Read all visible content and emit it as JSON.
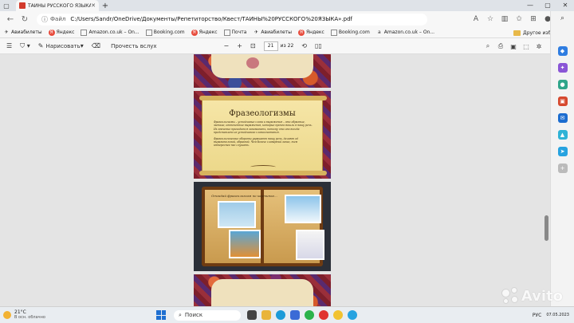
{
  "browser": {
    "tab_title": "ТАЙНЫ РУССКОГО ЯЗЫКА».pdf",
    "address_label": "Файл",
    "url": "C:/Users/Sandr/OneDrive/Документы/Репетиторство/Квест/ТАЙНЫ%20РУССКОГО%20ЯЗЫКА».pdf"
  },
  "bookmarks": [
    {
      "label": "Авиабилеты"
    },
    {
      "label": "Яндекс"
    },
    {
      "label": "Amazon.co.uk – On..."
    },
    {
      "label": "Booking.com"
    },
    {
      "label": "Яндекс"
    },
    {
      "label": "Почта"
    },
    {
      "label": "Авиабилеты"
    },
    {
      "label": "Яндекс"
    },
    {
      "label": "Booking.com"
    },
    {
      "label": "Amazon.co.uk – On..."
    }
  ],
  "bookmarks_other": "Другое избранное",
  "pdf_toolbar": {
    "draw_label": "Нарисовать",
    "read_aloud_label": "Прочесть вслух",
    "page_current": "21",
    "page_total": "из 22"
  },
  "document": {
    "page2_title": "Фразеологизмы",
    "page2_body1": "Фразеологизмы – устойчивые слова и выражения – это образные, меткие, отточенные выражения, которые прочно вошли в нашу речь. Их значение приходится запоминать, потому что оно всегда представлено из устойчивого словосочетания.",
    "page2_body2": "Фразеологические обороты украшают нашу речь, делают её выразительной, образной. Чем богаче словарный запас, тем интереснее нас слушать.",
    "page3_caption": "Отгадай фразеологизм по картинке..."
  },
  "taskbar": {
    "weather_temp": "21°C",
    "weather_desc": "В осн. облачно",
    "search_label": "Поиск",
    "lang": "РУС",
    "date": "07.05.2023",
    "watermark": "Avito"
  },
  "colors": {
    "accent": "#1f6fd1",
    "pdf_red": "#d23a2c"
  }
}
